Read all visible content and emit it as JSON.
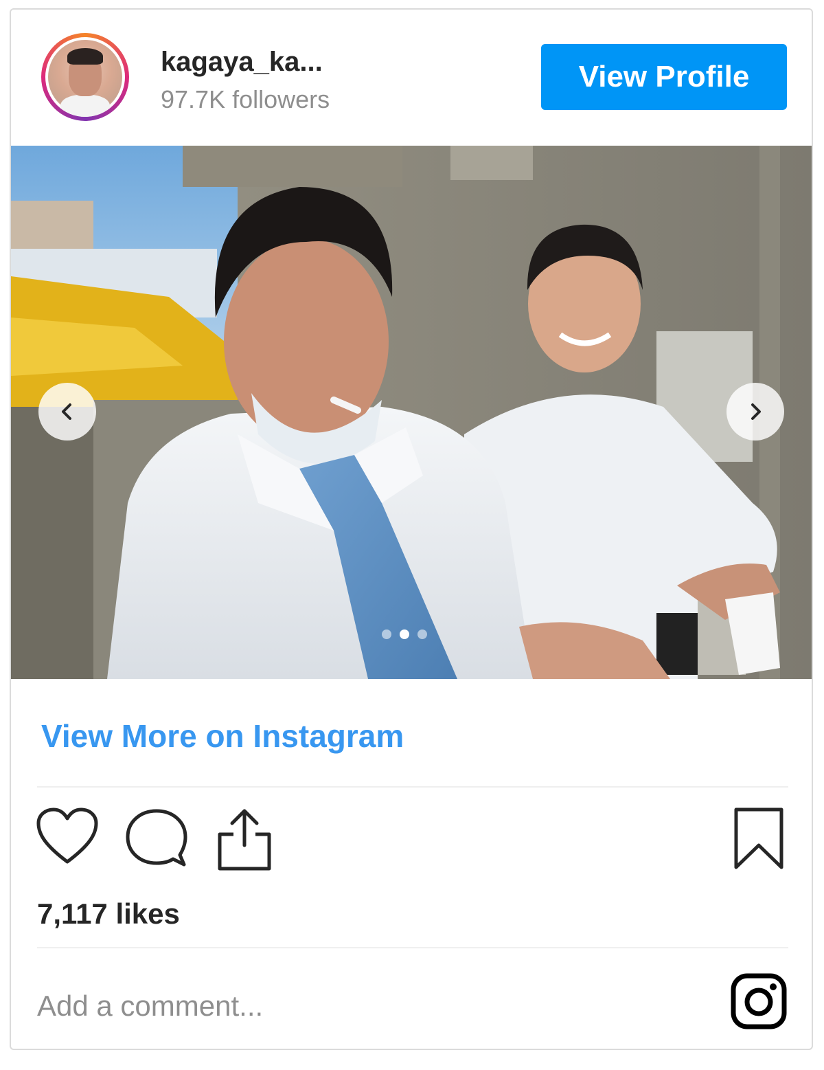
{
  "header": {
    "username": "kagaya_ka...",
    "followers": "97.7K followers",
    "view_profile_label": "View Profile"
  },
  "media": {
    "carousel": {
      "count": 3,
      "active_index": 1
    }
  },
  "footer": {
    "view_more_label": "View More on Instagram",
    "likes": "7,117 likes",
    "comment_placeholder": "Add a comment..."
  },
  "icons": {
    "like": "heart-icon",
    "comment": "comment-icon",
    "share": "share-icon",
    "save": "bookmark-icon",
    "brand": "instagram-logo-icon",
    "prev": "chevron-left-icon",
    "next": "chevron-right-icon"
  },
  "colors": {
    "accent": "#0095f6",
    "link": "#3897f0",
    "text": "#262626",
    "muted": "#8e8e8e",
    "border": "#dbdbdb"
  }
}
